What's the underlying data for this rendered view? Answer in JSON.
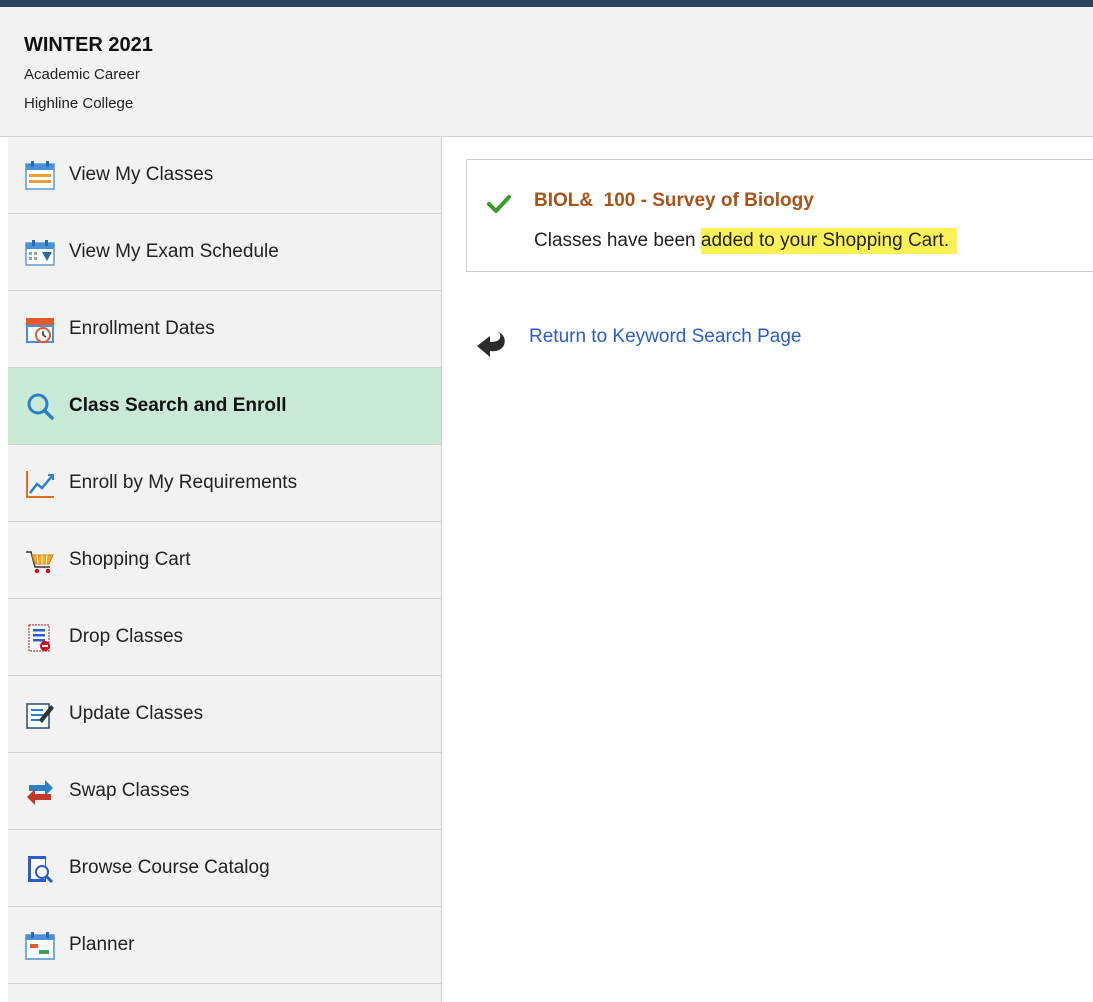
{
  "header": {
    "term": "WINTER 2021",
    "career": "Academic Career",
    "institution": "Highline College"
  },
  "sidebar": {
    "items": [
      {
        "label": "View My Classes",
        "icon": "calendar-icon"
      },
      {
        "label": "View My Exam Schedule",
        "icon": "exam-calendar-icon"
      },
      {
        "label": "Enrollment Dates",
        "icon": "calendar-clock-icon"
      },
      {
        "label": "Class Search and Enroll",
        "icon": "search-icon",
        "active": true
      },
      {
        "label": "Enroll by My Requirements",
        "icon": "line-chart-icon"
      },
      {
        "label": "Shopping Cart",
        "icon": "shopping-cart-icon"
      },
      {
        "label": "Drop Classes",
        "icon": "drop-document-icon"
      },
      {
        "label": "Update Classes",
        "icon": "edit-document-icon"
      },
      {
        "label": "Swap Classes",
        "icon": "swap-arrows-icon"
      },
      {
        "label": "Browse Course Catalog",
        "icon": "catalog-search-icon"
      },
      {
        "label": "Planner",
        "icon": "planner-icon"
      }
    ]
  },
  "message": {
    "course": "BIOL&  100 - Survey of Biology",
    "text_prefix": "Classes have been ",
    "text_highlight": "added to your Shopping Cart."
  },
  "return_link": "Return to Keyword Search Page",
  "colors": {
    "course_title": "#a8531a",
    "link": "#2a5dc8",
    "active_nav": "#c8e9d6",
    "highlight": "#fbf25a",
    "top_bar": "#2b4260"
  }
}
